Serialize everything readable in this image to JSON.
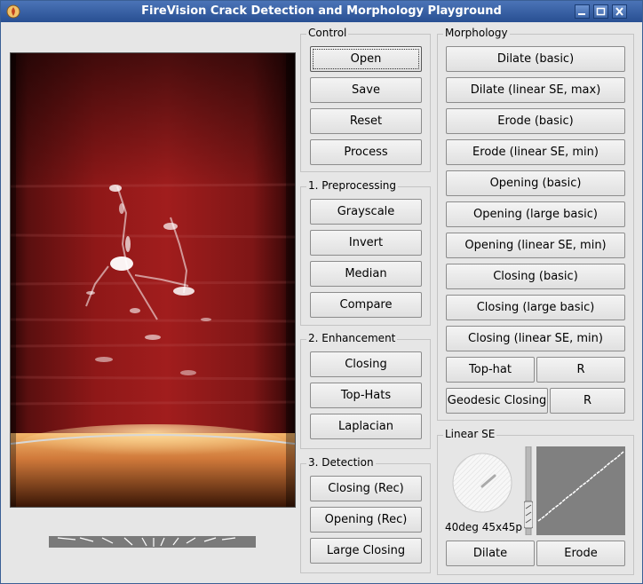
{
  "window": {
    "title": "FireVision Crack Detection and Morphology Playground",
    "controls": [
      "minimize",
      "maximize",
      "close"
    ]
  },
  "control": {
    "title": "Control",
    "buttons": [
      "Open",
      "Save",
      "Reset",
      "Process"
    ]
  },
  "preprocessing": {
    "title": "1. Preprocessing",
    "buttons": [
      "Grayscale",
      "Invert",
      "Median",
      "Compare"
    ]
  },
  "enhancement": {
    "title": "2. Enhancement",
    "buttons": [
      "Closing",
      "Top-Hats",
      "Laplacian"
    ]
  },
  "detection": {
    "title": "3. Detection",
    "buttons": [
      "Closing (Rec)",
      "Opening (Rec)",
      "Large Closing"
    ]
  },
  "morphology": {
    "title": "Morphology",
    "buttons": [
      "Dilate (basic)",
      "Dilate (linear SE, max)",
      "Erode (basic)",
      "Erode (linear SE, min)",
      "Opening (basic)",
      "Opening (large basic)",
      "Opening (linear SE, min)",
      "Closing (basic)",
      "Closing (large basic)",
      "Closing (linear SE, min)"
    ],
    "tophat": "Top-hat",
    "tophat_r": "R",
    "geodesic": "Geodesic Closing",
    "geodesic_r": "R"
  },
  "linear_se": {
    "title": "Linear SE",
    "label": "40deg 45x45p",
    "dilate": "Dilate",
    "erode": "Erode"
  },
  "colors": {
    "titlebar": "#3a62a4",
    "window_bg": "#e6e6e6",
    "button_face": "#ececec",
    "preview_bg": "#808080"
  },
  "icons": {
    "app": "fire-icon",
    "minimize": "minimize-icon",
    "maximize": "maximize-icon",
    "close": "close-icon"
  }
}
